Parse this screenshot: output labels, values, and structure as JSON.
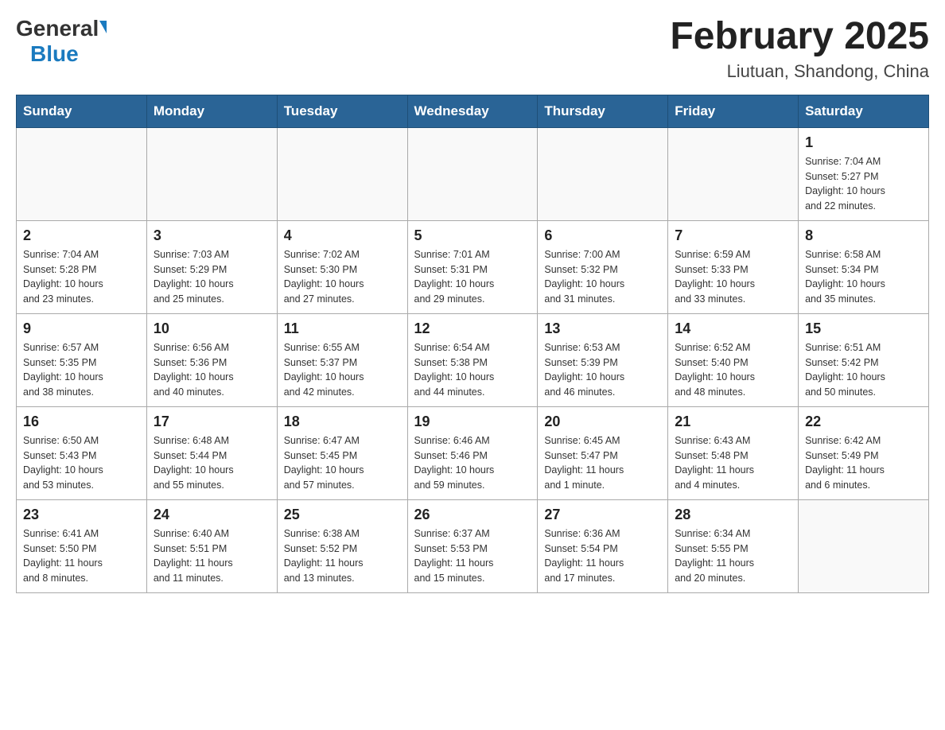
{
  "logo": {
    "general": "General",
    "blue": "Blue"
  },
  "title": "February 2025",
  "location": "Liutuan, Shandong, China",
  "days_of_week": [
    "Sunday",
    "Monday",
    "Tuesday",
    "Wednesday",
    "Thursday",
    "Friday",
    "Saturday"
  ],
  "weeks": [
    [
      {
        "day": "",
        "info": ""
      },
      {
        "day": "",
        "info": ""
      },
      {
        "day": "",
        "info": ""
      },
      {
        "day": "",
        "info": ""
      },
      {
        "day": "",
        "info": ""
      },
      {
        "day": "",
        "info": ""
      },
      {
        "day": "1",
        "info": "Sunrise: 7:04 AM\nSunset: 5:27 PM\nDaylight: 10 hours\nand 22 minutes."
      }
    ],
    [
      {
        "day": "2",
        "info": "Sunrise: 7:04 AM\nSunset: 5:28 PM\nDaylight: 10 hours\nand 23 minutes."
      },
      {
        "day": "3",
        "info": "Sunrise: 7:03 AM\nSunset: 5:29 PM\nDaylight: 10 hours\nand 25 minutes."
      },
      {
        "day": "4",
        "info": "Sunrise: 7:02 AM\nSunset: 5:30 PM\nDaylight: 10 hours\nand 27 minutes."
      },
      {
        "day": "5",
        "info": "Sunrise: 7:01 AM\nSunset: 5:31 PM\nDaylight: 10 hours\nand 29 minutes."
      },
      {
        "day": "6",
        "info": "Sunrise: 7:00 AM\nSunset: 5:32 PM\nDaylight: 10 hours\nand 31 minutes."
      },
      {
        "day": "7",
        "info": "Sunrise: 6:59 AM\nSunset: 5:33 PM\nDaylight: 10 hours\nand 33 minutes."
      },
      {
        "day": "8",
        "info": "Sunrise: 6:58 AM\nSunset: 5:34 PM\nDaylight: 10 hours\nand 35 minutes."
      }
    ],
    [
      {
        "day": "9",
        "info": "Sunrise: 6:57 AM\nSunset: 5:35 PM\nDaylight: 10 hours\nand 38 minutes."
      },
      {
        "day": "10",
        "info": "Sunrise: 6:56 AM\nSunset: 5:36 PM\nDaylight: 10 hours\nand 40 minutes."
      },
      {
        "day": "11",
        "info": "Sunrise: 6:55 AM\nSunset: 5:37 PM\nDaylight: 10 hours\nand 42 minutes."
      },
      {
        "day": "12",
        "info": "Sunrise: 6:54 AM\nSunset: 5:38 PM\nDaylight: 10 hours\nand 44 minutes."
      },
      {
        "day": "13",
        "info": "Sunrise: 6:53 AM\nSunset: 5:39 PM\nDaylight: 10 hours\nand 46 minutes."
      },
      {
        "day": "14",
        "info": "Sunrise: 6:52 AM\nSunset: 5:40 PM\nDaylight: 10 hours\nand 48 minutes."
      },
      {
        "day": "15",
        "info": "Sunrise: 6:51 AM\nSunset: 5:42 PM\nDaylight: 10 hours\nand 50 minutes."
      }
    ],
    [
      {
        "day": "16",
        "info": "Sunrise: 6:50 AM\nSunset: 5:43 PM\nDaylight: 10 hours\nand 53 minutes."
      },
      {
        "day": "17",
        "info": "Sunrise: 6:48 AM\nSunset: 5:44 PM\nDaylight: 10 hours\nand 55 minutes."
      },
      {
        "day": "18",
        "info": "Sunrise: 6:47 AM\nSunset: 5:45 PM\nDaylight: 10 hours\nand 57 minutes."
      },
      {
        "day": "19",
        "info": "Sunrise: 6:46 AM\nSunset: 5:46 PM\nDaylight: 10 hours\nand 59 minutes."
      },
      {
        "day": "20",
        "info": "Sunrise: 6:45 AM\nSunset: 5:47 PM\nDaylight: 11 hours\nand 1 minute."
      },
      {
        "day": "21",
        "info": "Sunrise: 6:43 AM\nSunset: 5:48 PM\nDaylight: 11 hours\nand 4 minutes."
      },
      {
        "day": "22",
        "info": "Sunrise: 6:42 AM\nSunset: 5:49 PM\nDaylight: 11 hours\nand 6 minutes."
      }
    ],
    [
      {
        "day": "23",
        "info": "Sunrise: 6:41 AM\nSunset: 5:50 PM\nDaylight: 11 hours\nand 8 minutes."
      },
      {
        "day": "24",
        "info": "Sunrise: 6:40 AM\nSunset: 5:51 PM\nDaylight: 11 hours\nand 11 minutes."
      },
      {
        "day": "25",
        "info": "Sunrise: 6:38 AM\nSunset: 5:52 PM\nDaylight: 11 hours\nand 13 minutes."
      },
      {
        "day": "26",
        "info": "Sunrise: 6:37 AM\nSunset: 5:53 PM\nDaylight: 11 hours\nand 15 minutes."
      },
      {
        "day": "27",
        "info": "Sunrise: 6:36 AM\nSunset: 5:54 PM\nDaylight: 11 hours\nand 17 minutes."
      },
      {
        "day": "28",
        "info": "Sunrise: 6:34 AM\nSunset: 5:55 PM\nDaylight: 11 hours\nand 20 minutes."
      },
      {
        "day": "",
        "info": ""
      }
    ]
  ]
}
